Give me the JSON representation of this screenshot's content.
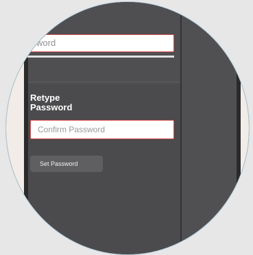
{
  "password_field": {
    "visible_text": "ssword"
  },
  "strength_meter": {
    "level": 0.04
  },
  "retype": {
    "label_line1": "Retype",
    "label_line2": "Password",
    "placeholder": "Confirm Password"
  },
  "actions": {
    "set_password_label": "Set Password"
  },
  "colors": {
    "panel": "#4b4b4d",
    "input_border": "#d94e4e",
    "strength_fill": "#e05a4a",
    "button_bg": "#5f5f62",
    "magnifier_border": "#a9c5d6"
  }
}
